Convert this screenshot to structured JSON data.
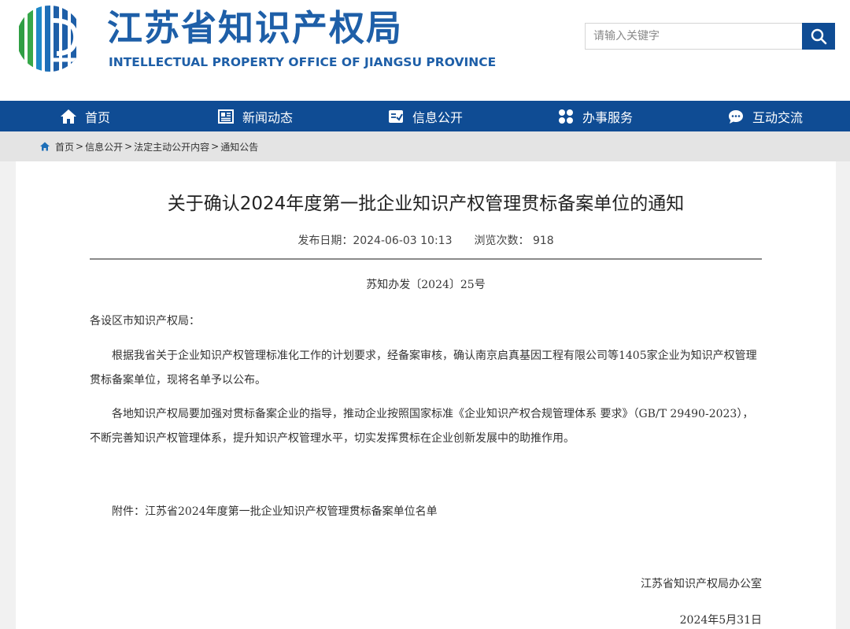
{
  "header": {
    "title_cn": "江苏省知识产权局",
    "title_en": "INTELLECTUAL PROPERTY OFFICE OF JIANGSU PROVINCE",
    "search": {
      "placeholder": "请输入关键字",
      "icon": "search-icon"
    }
  },
  "nav": [
    {
      "label": "首页",
      "icon": "home-icon"
    },
    {
      "label": "新闻动态",
      "icon": "newspaper-icon"
    },
    {
      "label": "信息公开",
      "icon": "info-board-icon"
    },
    {
      "label": "办事服务",
      "icon": "grid-icon"
    },
    {
      "label": "互动交流",
      "icon": "chat-icon"
    }
  ],
  "breadcrumb": {
    "items": [
      "首页",
      "信息公开",
      "法定主动公开内容",
      "通知公告"
    ],
    "separator": ">"
  },
  "article": {
    "title": "关于确认2024年度第一批企业知识产权管理贯标备案单位的通知",
    "publish_date_label": "发布日期：2024-06-03 10:13",
    "views_label": "浏览次数： 918",
    "doc_number": "苏知办发〔2024〕25号",
    "greeting": "各设区市知识产权局：",
    "paragraphs": [
      "根据我省关于企业知识产权管理标准化工作的计划要求，经备案审核，确认南京启真基因工程有限公司等1405家企业为知识产权管理贯标备案单位，现将名单予以公布。",
      "各地知识产权局要加强对贯标备案企业的指导，推动企业按照国家标准《企业知识产权合规管理体系 要求》（GB/T 29490-2023），不断完善知识产权管理体系，提升知识产权管理水平，切实发挥贯标在企业创新发展中的助推作用。"
    ],
    "attachment": "附件：江苏省2024年度第一批企业知识产权管理贯标备案单位名单",
    "signer": "江苏省知识产权局办公室",
    "sign_date": "2024年5月31日"
  },
  "colors": {
    "brand_blue": "#0f4c94",
    "logo_blue": "#1e5fa8",
    "logo_green": "#3aa84a"
  }
}
